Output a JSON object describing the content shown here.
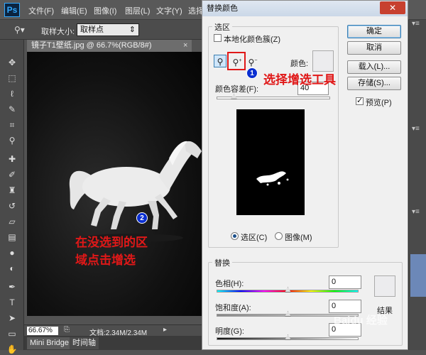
{
  "app": {
    "logo": "Ps",
    "menu": [
      "文件(F)",
      "编辑(E)",
      "图像(I)",
      "图层(L)",
      "文字(Y)",
      "选择"
    ]
  },
  "options_bar": {
    "sample_size_label": "取样大小:",
    "sample_size_value": "取样点"
  },
  "document": {
    "tab_title": "镜子T1壁纸.jpg @ 66.7%(RGB/8#)",
    "zoom": "66.67%",
    "doc_info": "文档:2.34M/2.34M"
  },
  "bottom_panels": [
    "Mini Bridge",
    "时间轴"
  ],
  "dialog": {
    "title": "替换颜色",
    "selection_group": "选区",
    "localized_label": "本地化颜色簇(Z)",
    "color_label": "颜色:",
    "fuzziness_label": "颜色容差(F):",
    "fuzziness_value": "40",
    "fuzziness_fraction": 0.15,
    "view_selection": "选区(C)",
    "view_image": "图像(M)",
    "buttons": {
      "ok": "确定",
      "cancel": "取消",
      "load": "载入(L)...",
      "save": "存储(S)..."
    },
    "preview_label": "预览(P)",
    "replace_group": "替换",
    "hue_label": "色相(H):",
    "hue_value": "0",
    "saturation_label": "饱和度(A):",
    "saturation_value": "0",
    "lightness_label": "明度(G):",
    "lightness_value": "0",
    "result_label": "结果"
  },
  "annotations": {
    "step1_number": "1",
    "step1_text": "选择增选工具",
    "step2_number": "2",
    "step2_text_line1": "在没选到的区",
    "step2_text_line2": "域点击增选"
  },
  "watermark": "Baidu 经验",
  "colors": {
    "annotation_red": "#e01818",
    "badge_blue": "#0a2fd1"
  }
}
